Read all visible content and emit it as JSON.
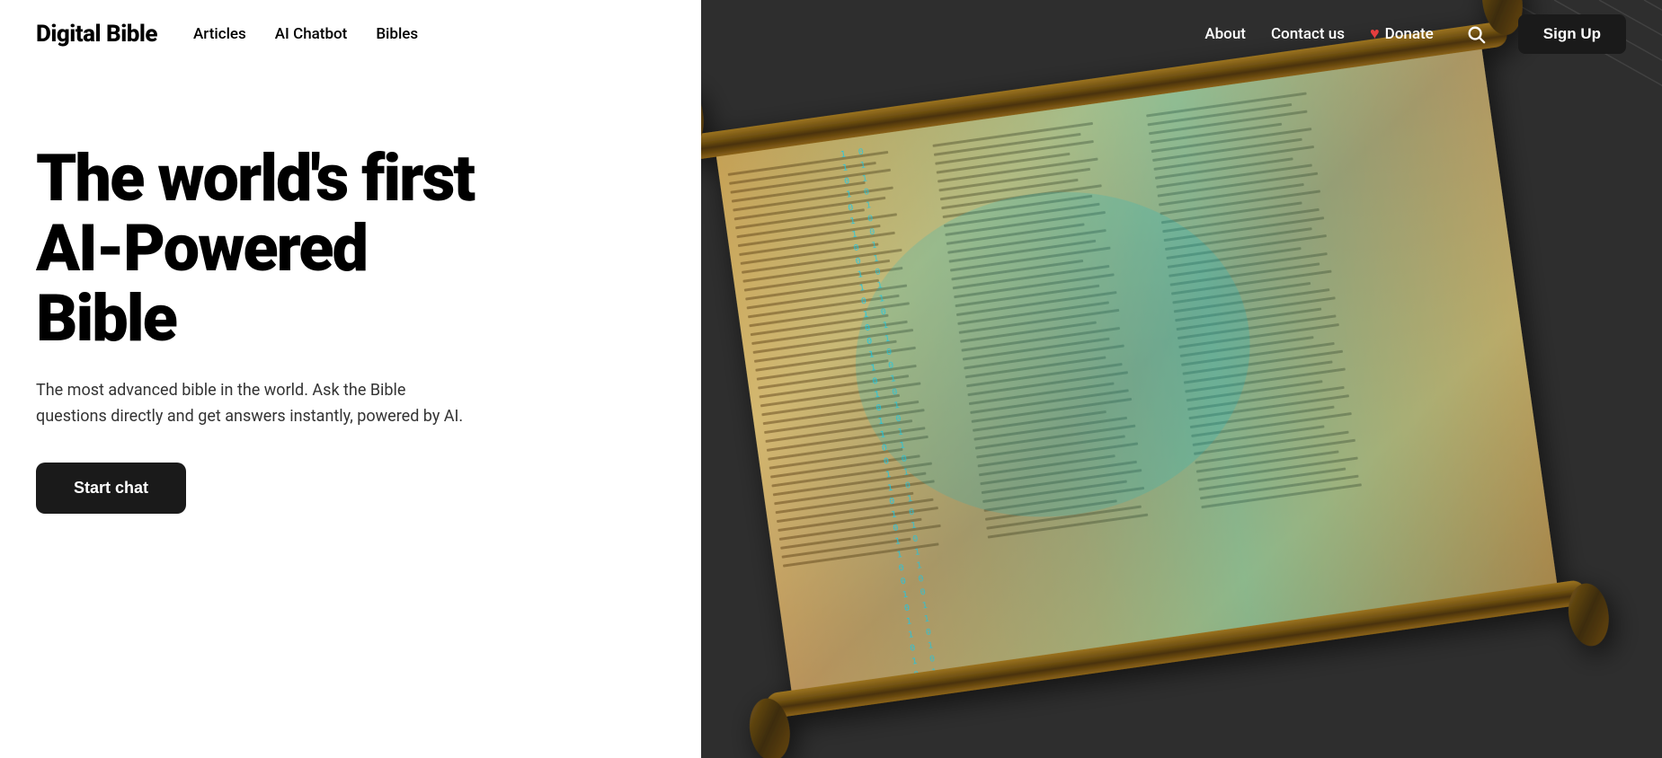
{
  "nav": {
    "logo": "Digital Bible",
    "links_left": [
      {
        "label": "Articles",
        "id": "articles"
      },
      {
        "label": "AI Chatbot",
        "id": "ai-chatbot"
      },
      {
        "label": "Bibles",
        "id": "bibles"
      }
    ],
    "links_right": [
      {
        "label": "About",
        "id": "about"
      },
      {
        "label": "Contact us",
        "id": "contact-us"
      },
      {
        "label": "Donate",
        "id": "donate"
      }
    ],
    "donate_heart": "♥",
    "search_icon": "🔍",
    "signup_label": "Sign Up"
  },
  "hero": {
    "title_line1": "The world's first",
    "title_line2": "AI-Powered",
    "title_line3": "Bible",
    "subtitle": "The most advanced bible in the world. Ask the Bible questions directly and get answers instantly, powered by AI.",
    "cta_label": "Start chat"
  },
  "colors": {
    "accent_red": "#e53e3e",
    "nav_bg_dark": "#2a2a2a",
    "text_dark": "#000000",
    "text_white": "#ffffff",
    "btn_dark": "#1a1a1a"
  }
}
